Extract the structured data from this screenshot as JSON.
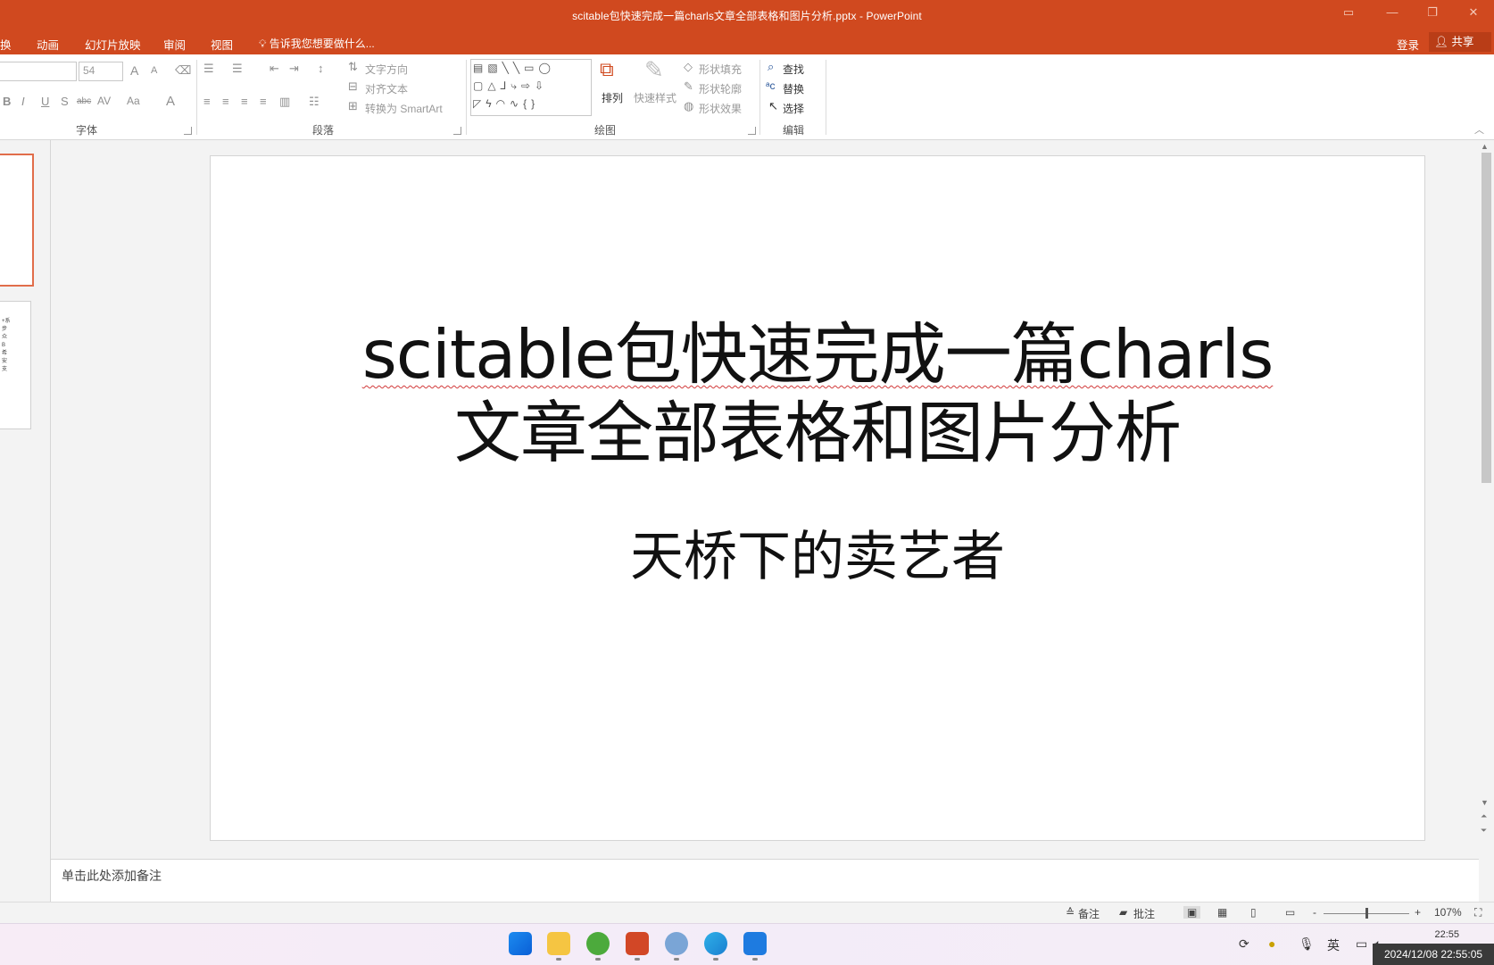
{
  "window": {
    "title": "scitable包快速完成一篇charls文章全部表格和图片分析.pptx - PowerPoint",
    "controls": [
      "ribbon-display-icon",
      "minimize-icon",
      "restore-icon",
      "close-icon"
    ]
  },
  "tabs": [
    {
      "label": "换"
    },
    {
      "label": "动画"
    },
    {
      "label": "幻灯片放映"
    },
    {
      "label": "审阅"
    },
    {
      "label": "视图"
    }
  ],
  "tell_me": "告诉我您想要做什么...",
  "account": {
    "signin": "登录",
    "share": "共享"
  },
  "ribbon": {
    "font": {
      "label": "字体",
      "font_size": "54",
      "grow_glyph": "A",
      "shrink_glyph": "A",
      "bold": "B",
      "italic": "I",
      "underline": "U",
      "shadow": "S",
      "strike": "abc",
      "spacing": "AV",
      "case": "Aa",
      "color": "A"
    },
    "paragraph": {
      "label": "段落",
      "text_direction": "文字方向",
      "align_text": "对齐文本",
      "smartart": "转换为 SmartArt"
    },
    "drawing": {
      "label": "绘图",
      "arrange": "排列",
      "quick_styles": "快速样式",
      "shape_fill": "形状填充",
      "shape_outline": "形状轮廓",
      "shape_effects": "形状效果"
    },
    "editing": {
      "label": "编辑",
      "find": "查找",
      "replace": "替换",
      "select": "选择"
    }
  },
  "thumbnail_2_text": "+系步众B希安支",
  "slide": {
    "title_line1": "scitable包快速完成一篇charls",
    "title_line2": "文章全部表格和图片分析",
    "subtitle": "天桥下的卖艺者"
  },
  "notes_placeholder": "单击此处添加备注",
  "status": {
    "notes": "备注",
    "comments": "批注",
    "zoom_minus": "-",
    "zoom_plus": "+",
    "zoom": "107%"
  },
  "taskbar": {
    "apps": [
      "windows-start-icon",
      "file-explorer-icon",
      "edge-legacy-icon",
      "powerpoint-icon",
      "r-icon",
      "edge-icon",
      "photos-icon"
    ],
    "ime": "英",
    "time": "22:55",
    "timestamp": "2024/12/08 22:55:05"
  },
  "colors": {
    "accent": "#d0491f",
    "selection": "#e16d4a"
  }
}
